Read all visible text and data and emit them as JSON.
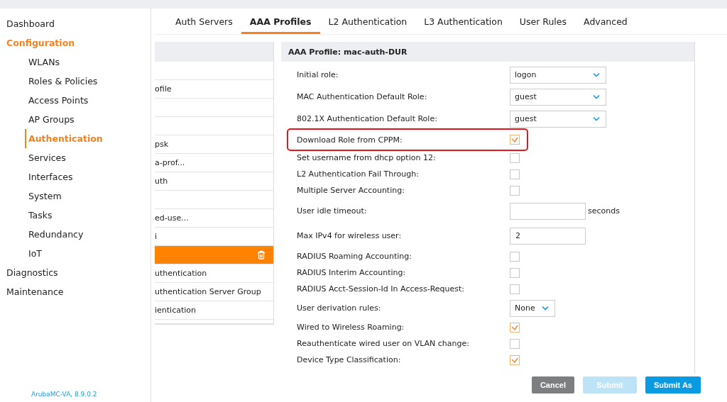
{
  "sidebar": {
    "items": [
      {
        "label": "Dashboard",
        "selected": false
      },
      {
        "label": "Configuration",
        "selected": true,
        "children": [
          {
            "label": "WLANs",
            "selected": false
          },
          {
            "label": "Roles & Policies",
            "selected": false
          },
          {
            "label": "Access Points",
            "selected": false
          },
          {
            "label": "AP Groups",
            "selected": false
          },
          {
            "label": "Authentication",
            "selected": true
          },
          {
            "label": "Services",
            "selected": false
          },
          {
            "label": "Interfaces",
            "selected": false
          },
          {
            "label": "System",
            "selected": false
          },
          {
            "label": "Tasks",
            "selected": false
          },
          {
            "label": "Redundancy",
            "selected": false
          },
          {
            "label": "IoT",
            "selected": false
          }
        ]
      },
      {
        "label": "Diagnostics",
        "selected": false
      },
      {
        "label": "Maintenance",
        "selected": false
      }
    ],
    "version": "ArubaMC-VA, 8.9.0.2"
  },
  "tabs": [
    {
      "label": "Auth Servers",
      "selected": false
    },
    {
      "label": "AAA Profiles",
      "selected": true
    },
    {
      "label": "L2 Authentication",
      "selected": false
    },
    {
      "label": "L3 Authentication",
      "selected": false
    },
    {
      "label": "User Rules",
      "selected": false
    },
    {
      "label": "Advanced",
      "selected": false
    }
  ],
  "profile_list": {
    "rows": [
      {
        "text": "",
        "selected": false
      },
      {
        "text": "ofile",
        "selected": false
      },
      {
        "text": "",
        "selected": false
      },
      {
        "text": "",
        "selected": false
      },
      {
        "text": "psk",
        "selected": false
      },
      {
        "text": "a-prof...",
        "selected": false
      },
      {
        "text": "uth",
        "selected": false
      },
      {
        "text": "",
        "selected": false
      },
      {
        "text": "ed-use...",
        "selected": false
      },
      {
        "text": "i",
        "selected": false
      },
      {
        "text": "",
        "selected": true
      },
      {
        "text": "uthentication",
        "selected": false
      },
      {
        "text": "uthentication Server Group",
        "selected": false
      },
      {
        "text": "ientication",
        "selected": false
      }
    ]
  },
  "profile_form": {
    "title": "AAA Profile: mac-auth-DUR",
    "fields": [
      {
        "kind": "select",
        "label": "Initial role:",
        "value": "logon",
        "highlighted": false
      },
      {
        "kind": "select",
        "label": "MAC Authentication Default Role:",
        "value": "guest",
        "highlighted": false
      },
      {
        "kind": "select",
        "label": "802.1X Authentication Default Role:",
        "value": "guest",
        "highlighted": false
      },
      {
        "kind": "checkbox",
        "label": "Download Role from CPPM:",
        "checked": true,
        "highlighted": true
      },
      {
        "kind": "checkbox",
        "label": "Set username from dhcp option 12:",
        "checked": false,
        "highlighted": false
      },
      {
        "kind": "checkbox",
        "label": "L2 Authentication Fail Through:",
        "checked": false,
        "highlighted": false
      },
      {
        "kind": "checkbox",
        "label": "Multiple Server Accounting:",
        "checked": false,
        "highlighted": false
      },
      {
        "kind": "input",
        "label": "User idle timeout:",
        "suffix": "seconds",
        "highlighted": false
      },
      {
        "kind": "input",
        "label": "Max IPv4 for wireless user:",
        "value": "2",
        "highlighted": false
      },
      {
        "kind": "checkbox",
        "label": "RADIUS Roaming Accounting:",
        "checked": false,
        "highlighted": false
      },
      {
        "kind": "checkbox",
        "label": "RADIUS Interim Accounting:",
        "checked": false,
        "highlighted": false
      },
      {
        "kind": "checkbox",
        "label": "RADIUS Acct-Session-Id In Access-Request:",
        "checked": false,
        "highlighted": false
      },
      {
        "kind": "smallselect",
        "label": "User derivation rules:",
        "value": "None",
        "highlighted": false
      },
      {
        "kind": "checkbox",
        "label": "Wired to Wireless Roaming:",
        "checked": true,
        "highlighted": false
      },
      {
        "kind": "checkbox",
        "label": "Reauthenticate wired user on VLAN change:",
        "checked": false,
        "highlighted": false
      },
      {
        "kind": "checkbox",
        "label": "Device Type Classification:",
        "checked": true,
        "highlighted": false
      }
    ]
  },
  "actions": [
    {
      "label": "Cancel",
      "kind": "cancel",
      "disabled": false
    },
    {
      "label": "Submit",
      "kind": "primary",
      "disabled": true
    },
    {
      "label": "Submit As",
      "kind": "primary",
      "disabled": false
    }
  ]
}
